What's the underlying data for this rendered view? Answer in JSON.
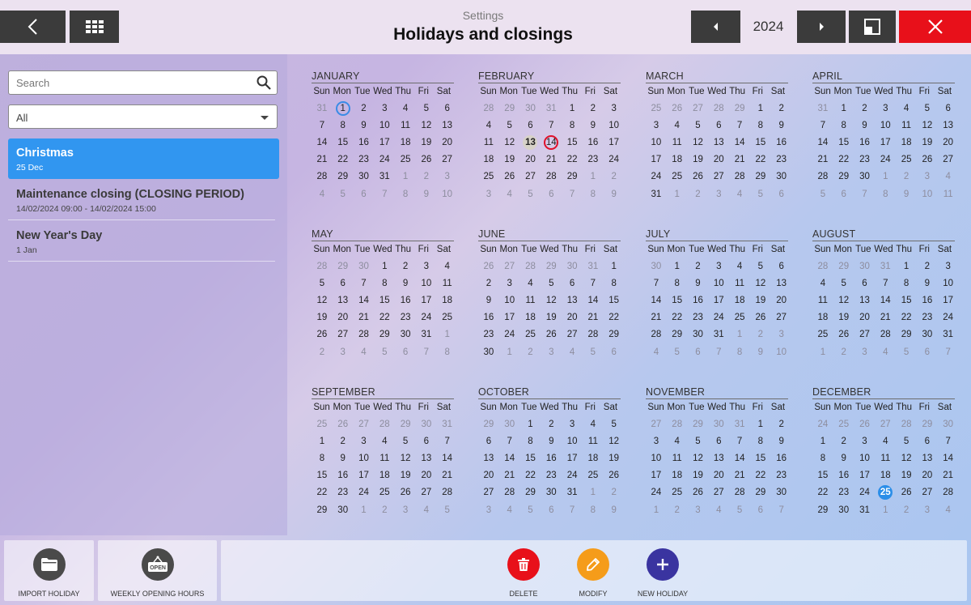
{
  "header": {
    "subtitle": "Settings",
    "title": "Holidays and closings",
    "year": "2024",
    "colors": {
      "dark_button": "#3b3b3b",
      "close_button": "#e8101a"
    }
  },
  "sidebar": {
    "search": {
      "placeholder": "Search",
      "value": ""
    },
    "filter": {
      "value": "All"
    },
    "items": [
      {
        "name": "Christmas",
        "date": "25 Dec",
        "selected": true
      },
      {
        "name": "Maintenance closing (CLOSING PERIOD)",
        "date": "14/02/2024 09:00 - 14/02/2024 15:00",
        "selected": false
      },
      {
        "name": "New Year's Day",
        "date": "1 Jan",
        "selected": false
      }
    ]
  },
  "calendar": {
    "weekdays": [
      "Sun",
      "Mon",
      "Tue",
      "Wed",
      "Thu",
      "Fri",
      "Sat"
    ],
    "months": [
      {
        "name": "JANUARY",
        "lead": [
          31
        ],
        "days": 31,
        "trail": [
          1,
          2,
          3,
          4,
          5,
          6,
          7,
          8,
          9,
          10
        ],
        "marks": {
          "1": "blue-ring"
        }
      },
      {
        "name": "FEBRUARY",
        "lead": [
          28,
          29,
          30,
          31
        ],
        "days": 29,
        "trail": [
          1,
          2,
          3,
          4,
          5,
          6,
          7,
          8,
          9
        ],
        "marks": {
          "13": "grey",
          "14": "red-ring"
        }
      },
      {
        "name": "MARCH",
        "lead": [
          25,
          26,
          27,
          28,
          29
        ],
        "days": 31,
        "trail": [
          1,
          2,
          3,
          4,
          5,
          6
        ],
        "marks": {}
      },
      {
        "name": "APRIL",
        "lead": [
          31
        ],
        "days": 30,
        "trail": [
          1,
          2,
          3,
          4,
          5,
          6,
          7,
          8,
          9,
          10,
          11
        ],
        "marks": {}
      },
      {
        "name": "MAY",
        "lead": [
          28,
          29,
          30
        ],
        "days": 31,
        "trail": [
          1,
          2,
          3,
          4,
          5,
          6,
          7,
          8
        ],
        "marks": {}
      },
      {
        "name": "JUNE",
        "lead": [
          26,
          27,
          28,
          29,
          30,
          31
        ],
        "days": 30,
        "trail": [
          1,
          2,
          3,
          4,
          5,
          6
        ],
        "marks": {}
      },
      {
        "name": "JULY",
        "lead": [
          30
        ],
        "days": 31,
        "trail": [
          1,
          2,
          3,
          4,
          5,
          6,
          7,
          8,
          9,
          10
        ],
        "marks": {}
      },
      {
        "name": "AUGUST",
        "lead": [
          28,
          29,
          30,
          31
        ],
        "days": 31,
        "trail": [
          1,
          2,
          3,
          4,
          5,
          6,
          7
        ],
        "marks": {}
      },
      {
        "name": "SEPTEMBER",
        "lead": [
          25,
          26,
          27,
          28,
          29,
          30,
          31
        ],
        "days": 30,
        "trail": [
          1,
          2,
          3,
          4,
          5
        ],
        "marks": {}
      },
      {
        "name": "OCTOBER",
        "lead": [
          29,
          30
        ],
        "days": 31,
        "trail": [
          1,
          2,
          3,
          4,
          5,
          6,
          7,
          8,
          9
        ],
        "marks": {}
      },
      {
        "name": "NOVEMBER",
        "lead": [
          27,
          28,
          29,
          30,
          31
        ],
        "days": 30,
        "trail": [
          1,
          2,
          3,
          4,
          5,
          6,
          7
        ],
        "marks": {}
      },
      {
        "name": "DECEMBER",
        "lead": [
          24,
          25,
          26,
          27,
          28,
          29,
          30
        ],
        "days": 31,
        "trail": [
          1,
          2,
          3,
          4
        ],
        "marks": {
          "25": "blue"
        }
      }
    ]
  },
  "footer": {
    "import_label": "IMPORT HOLIDAY",
    "weekly_label": "WEEKLY OPENING HOURS",
    "open_sign_text": "OPEN",
    "delete_label": "DELETE",
    "modify_label": "MODIFY",
    "new_label": "NEW HOLIDAY",
    "colors": {
      "icon_grey": "#4a4a4a",
      "delete": "#e8101a",
      "modify": "#f59c1a",
      "new": "#3a34a0"
    }
  }
}
